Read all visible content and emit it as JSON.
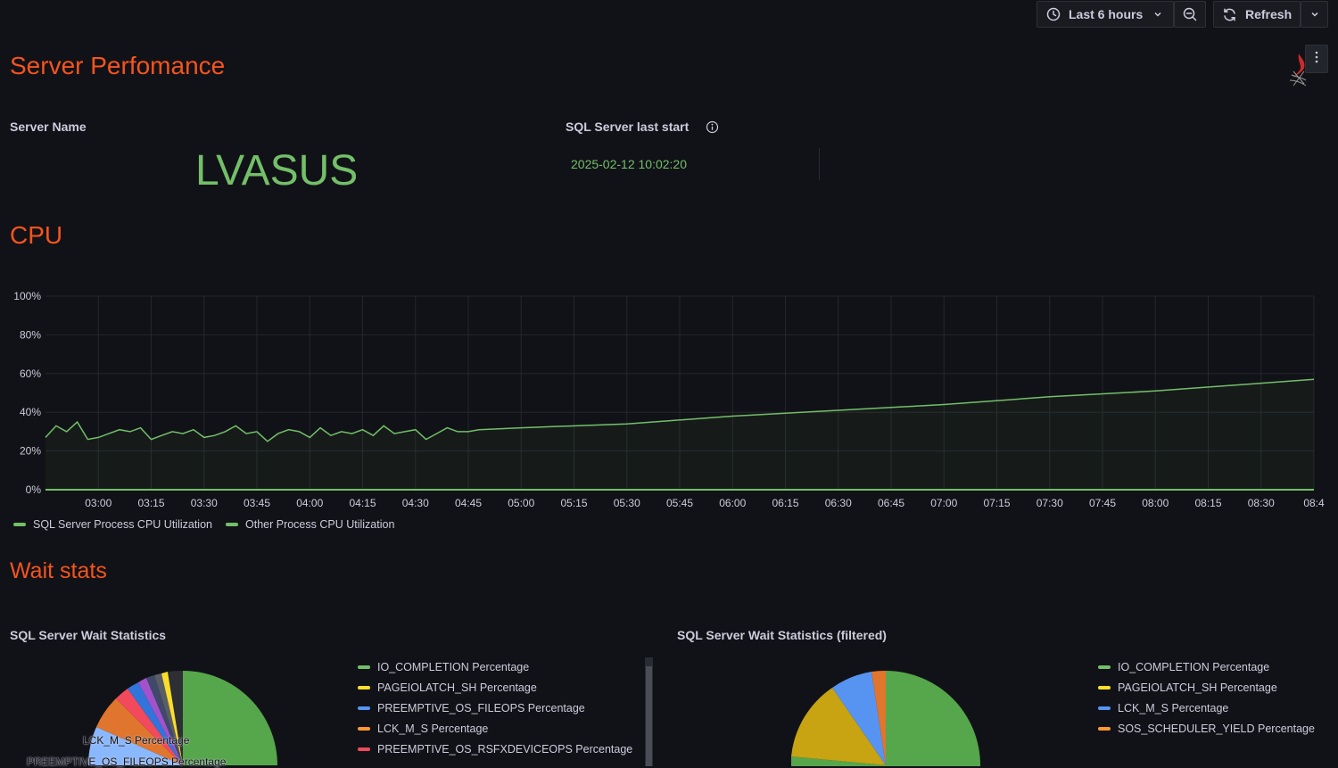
{
  "toolbar": {
    "time_range_label": "Last 6 hours",
    "refresh_label": "Refresh"
  },
  "dashboard": {
    "server_section_title": "Server Perfomance",
    "cpu_section_title": "CPU",
    "wait_section_title": "Wait stats"
  },
  "server_name_panel": {
    "title": "Server Name",
    "value": "LVASUS"
  },
  "last_start_panel": {
    "title": "SQL Server last start",
    "value": "2025-02-12 10:02:20"
  },
  "wait_panel": {
    "title": "SQL Server Wait Statistics",
    "legend": [
      {
        "label": "IO_COMPLETION Percentage",
        "color": "#73bf69"
      },
      {
        "label": "PAGEIOLATCH_SH Percentage",
        "color": "#fade2a"
      },
      {
        "label": "PREEMPTIVE_OS_FILEOPS Percentage",
        "color": "#5794f2"
      },
      {
        "label": "LCK_M_S Percentage",
        "color": "#ff9830"
      },
      {
        "label": "PREEMPTIVE_OS_RSFXDEVICEOPS Percentage",
        "color": "#f2495c"
      }
    ],
    "pie_labels": [
      "LCK_M_S Percentage",
      "PREEMPTIVE_OS_FILEOPS Percentage"
    ]
  },
  "wait_filtered_panel": {
    "title": "SQL Server Wait Statistics (filtered)",
    "legend": [
      {
        "label": "IO_COMPLETION Percentage",
        "color": "#73bf69"
      },
      {
        "label": "PAGEIOLATCH_SH Percentage",
        "color": "#fade2a"
      },
      {
        "label": "LCK_M_S Percentage",
        "color": "#5794f2"
      },
      {
        "label": "SOS_SCHEDULER_YIELD Percentage",
        "color": "#ff9830"
      }
    ]
  },
  "chart_data": {
    "type": "line",
    "ylim": [
      0,
      100
    ],
    "y_ticks": [
      "0%",
      "20%",
      "40%",
      "60%",
      "80%",
      "100%"
    ],
    "x_ticks": [
      "03:00",
      "03:15",
      "03:30",
      "03:45",
      "04:00",
      "04:15",
      "04:30",
      "04:45",
      "05:00",
      "05:15",
      "05:30",
      "05:45",
      "06:00",
      "06:15",
      "06:30",
      "06:45",
      "07:00",
      "07:15",
      "07:30",
      "07:45",
      "08:00",
      "08:15",
      "08:30",
      "08:4"
    ],
    "grid": true,
    "legend_placement": "bottom-left",
    "series": [
      {
        "name": "SQL Server Process CPU Utilization",
        "color": "#73bf69",
        "x": [
          "02:45",
          "03:00",
          "03:15",
          "03:30",
          "03:45",
          "04:00",
          "04:15",
          "04:30",
          "04:45",
          "05:00",
          "06:00",
          "07:00",
          "08:00",
          "08:45"
        ],
        "values": [
          0,
          0,
          0,
          0,
          0,
          0,
          0,
          0,
          0,
          0,
          0,
          0,
          0,
          0
        ]
      },
      {
        "name": "Other Process CPU Utilization",
        "color": "#73bf69",
        "x": [
          "02:45",
          "02:48",
          "02:51",
          "02:54",
          "02:57",
          "03:00",
          "03:03",
          "03:06",
          "03:09",
          "03:12",
          "03:15",
          "03:18",
          "03:21",
          "03:24",
          "03:27",
          "03:30",
          "03:33",
          "03:36",
          "03:39",
          "03:42",
          "03:45",
          "03:48",
          "03:51",
          "03:54",
          "03:57",
          "04:00",
          "04:03",
          "04:06",
          "04:09",
          "04:12",
          "04:15",
          "04:18",
          "04:21",
          "04:24",
          "04:27",
          "04:30",
          "04:33",
          "04:36",
          "04:39",
          "04:42",
          "04:45",
          "04:48",
          "05:00",
          "05:30",
          "06:00",
          "06:30",
          "07:00",
          "07:30",
          "08:00",
          "08:30",
          "08:45"
        ],
        "values": [
          27,
          33,
          30,
          35,
          26,
          27,
          29,
          31,
          30,
          32,
          26,
          28,
          30,
          29,
          31,
          27,
          28,
          30,
          33,
          29,
          30,
          25,
          29,
          31,
          30,
          27,
          32,
          28,
          30,
          29,
          31,
          28,
          33,
          29,
          30,
          31,
          26,
          29,
          32,
          30,
          30,
          31,
          32,
          34,
          38,
          41,
          44,
          48,
          51,
          55,
          57
        ]
      }
    ]
  }
}
